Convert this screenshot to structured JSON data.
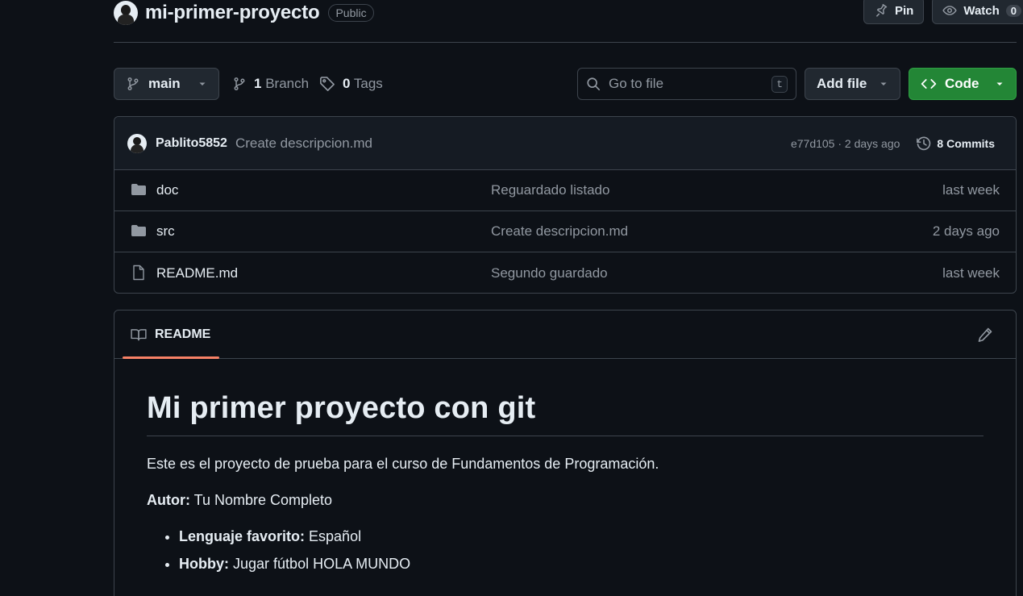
{
  "repo": {
    "name": "mi-primer-proyecto",
    "visibility": "Public"
  },
  "actions": {
    "pin_label": "Pin",
    "watch_label": "Watch",
    "watch_count": "0"
  },
  "toolbar": {
    "branch": "main",
    "branch_count": "1",
    "branch_label": "Branch",
    "tag_count": "0",
    "tag_label": "Tags",
    "search_placeholder": "Go to file",
    "search_shortcut": "t",
    "add_file_label": "Add file",
    "code_label": "Code"
  },
  "latest_commit": {
    "author": "Pablito5852",
    "message": "Create descripcion.md",
    "meta": "e77d105 · 2 days ago",
    "commits_label": "8 Commits"
  },
  "files": [
    {
      "name": "doc",
      "type": "folder",
      "message": "Reguardado listado",
      "date": "last week"
    },
    {
      "name": "src",
      "type": "folder",
      "message": "Create descripcion.md",
      "date": "2 days ago"
    },
    {
      "name": "README.md",
      "type": "file",
      "message": "Segundo guardado",
      "date": "last week"
    }
  ],
  "readme": {
    "tab_label": "README",
    "title": "Mi primer proyecto con git",
    "intro": "Este es el proyecto de prueba para el curso de Fundamentos de Programación.",
    "author_label": "Autor:",
    "author_value": "Tu Nombre Completo",
    "items": [
      {
        "label": "Lenguaje favorito:",
        "value": "Español"
      },
      {
        "label": "Hobby:",
        "value": "Jugar fútbol HOLA MUNDO"
      }
    ]
  },
  "colors": {
    "background": "#0d1117",
    "accent_green": "#238636",
    "tab_underline": "#f78166",
    "border": "#3d444d"
  }
}
